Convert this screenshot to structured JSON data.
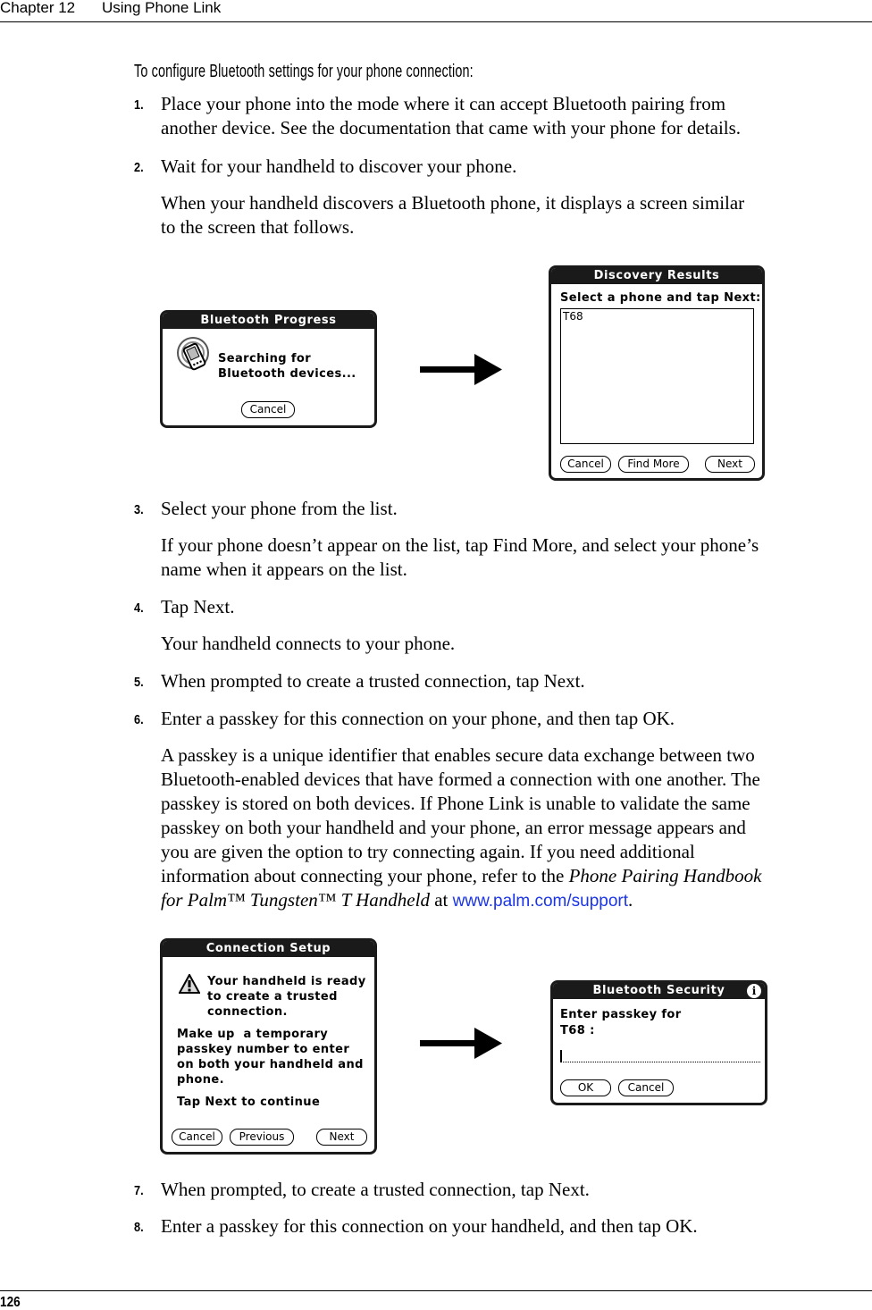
{
  "running_head": {
    "chapter": "Chapter 12",
    "title": "Using Phone Link"
  },
  "page_number": "126",
  "procedure_heading": "To configure Bluetooth settings for your phone connection:",
  "steps": [
    {
      "num": "1.",
      "lines": [
        "Place your phone into the mode where it can accept Bluetooth pairing from",
        "another device. See the documentation that came with your phone for details."
      ]
    },
    {
      "num": "2.",
      "lines": [
        "Wait for your handheld to discover your phone."
      ]
    },
    {
      "num": "3.",
      "lines": [
        "Select your phone from the list."
      ]
    },
    {
      "num": "4.",
      "lines": [
        "Tap Next."
      ]
    },
    {
      "num": "5.",
      "lines": [
        "When prompted to create a trusted connection, tap Next."
      ]
    },
    {
      "num": "6.",
      "lines": [
        "Enter a passkey for this connection on your phone, and then tap OK."
      ]
    },
    {
      "num": "7.",
      "lines": [
        "When prompted, to create a trusted connection, tap Next."
      ]
    },
    {
      "num": "8.",
      "lines": [
        "Enter a passkey for this connection on your handheld, and then tap OK."
      ]
    }
  ],
  "paragraphs": {
    "after_step2": [
      "When your handheld discovers a Bluetooth phone, it displays a screen similar",
      "to the screen that follows."
    ],
    "after_step3": [
      "If your phone doesn’t appear on the list, tap Find More, and select your phone’s",
      "name when it appears on the list."
    ],
    "after_step4": [
      "Your handheld connects to your phone."
    ],
    "after_step6": {
      "lines": [
        "A passkey is a unique identifier that enables secure data exchange between two",
        "Bluetooth-enabled devices that have formed a connection with one another. The",
        "passkey is stored on both devices. If Phone Link is unable to validate the same",
        "passkey on both your handheld and your phone, an error message appears and",
        "you are given the option to try connecting again. If you need additional"
      ],
      "line6_prefix": "information about connecting your phone, refer to the ",
      "line6_italic": "Phone Pairing Handbook",
      "line7_italic": "for Palm™ Tungsten™ T Handheld",
      "line7_mid": " at ",
      "line7_link": "www.palm.com/support",
      "line7_end": "."
    }
  },
  "screens": {
    "bluetooth_progress": {
      "title": "Bluetooth Progress",
      "message": [
        "Searching for",
        "Bluetooth devices..."
      ],
      "icon": "handheld-signal-icon",
      "cancel": "Cancel"
    },
    "discovery_results": {
      "title": "Discovery Results",
      "prompt": "Select a phone and tap Next:",
      "list_items": [
        "T68"
      ],
      "buttons": {
        "cancel": "Cancel",
        "find_more": "Find More",
        "next": "Next"
      }
    },
    "connection_setup": {
      "title": "Connection Setup",
      "icon": "warning-icon",
      "alert": [
        "Your handheld is ready",
        "to create a trusted",
        "connection."
      ],
      "body": [
        "Make up  a temporary",
        "passkey number to enter",
        "on both your handheld and",
        "phone."
      ],
      "instruction": "Tap Next to continue",
      "buttons": {
        "cancel": "Cancel",
        "previous": "Previous",
        "next": "Next"
      }
    },
    "bluetooth_security": {
      "title": "Bluetooth Security",
      "info_icon": "info-icon",
      "prompt": [
        "Enter passkey for",
        "T68 :"
      ],
      "passkey_value": "",
      "buttons": {
        "ok": "OK",
        "cancel": "Cancel"
      }
    }
  },
  "colors": {
    "link": "#1a34e6",
    "palm_titlebar": "#1a1a1a"
  }
}
